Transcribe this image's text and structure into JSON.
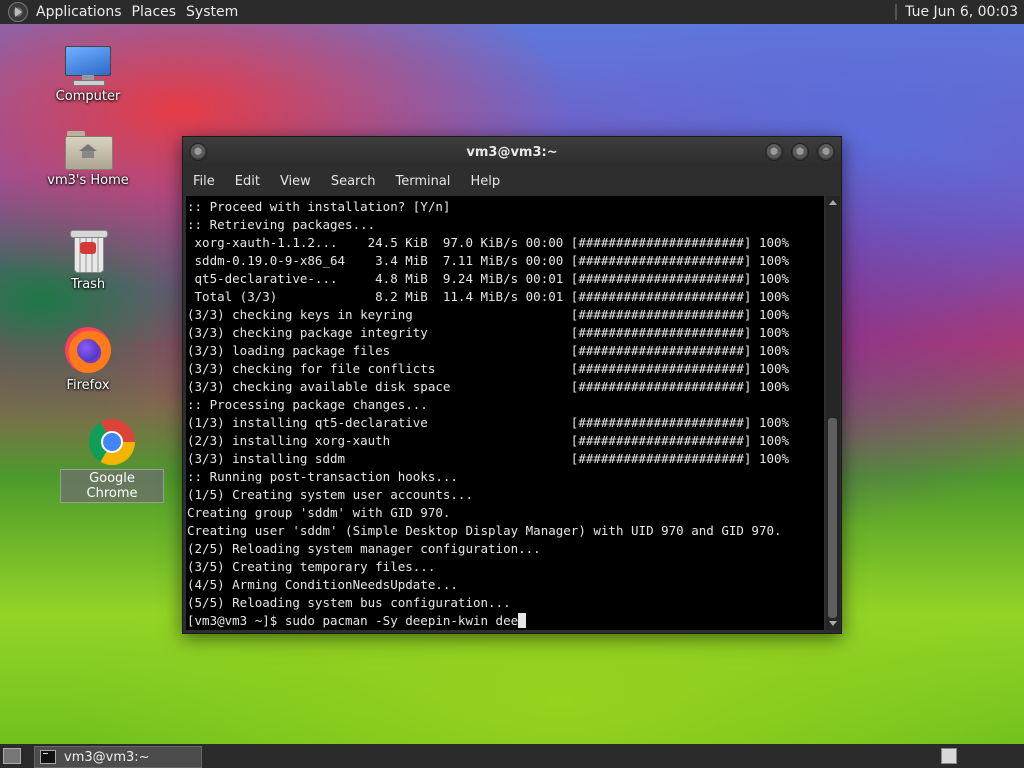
{
  "top_panel": {
    "menus": [
      "Applications",
      "Places",
      "System"
    ],
    "clock": "Tue Jun  6, 00:03"
  },
  "desktop_icons": [
    {
      "label": "Computer",
      "icon": "computer-icon"
    },
    {
      "label": "vm3's Home",
      "icon": "home-folder-icon"
    },
    {
      "label": "Trash",
      "icon": "trash-icon"
    },
    {
      "label": "Firefox",
      "icon": "firefox-icon"
    },
    {
      "label": "Google Chrome",
      "icon": "chrome-icon",
      "selected": true
    }
  ],
  "terminal": {
    "title": "vm3@vm3:~",
    "menu": [
      "File",
      "Edit",
      "View",
      "Search",
      "Terminal",
      "Help"
    ],
    "lines": [
      ":: Proceed with installation? [Y/n]",
      ":: Retrieving packages...",
      " xorg-xauth-1.1.2...    24.5 KiB  97.0 KiB/s 00:00 [######################] 100%",
      " sddm-0.19.0-9-x86_64    3.4 MiB  7.11 MiB/s 00:00 [######################] 100%",
      " qt5-declarative-...     4.8 MiB  9.24 MiB/s 00:01 [######################] 100%",
      " Total (3/3)             8.2 MiB  11.4 MiB/s 00:01 [######################] 100%",
      "(3/3) checking keys in keyring                     [######################] 100%",
      "(3/3) checking package integrity                   [######################] 100%",
      "(3/3) loading package files                        [######################] 100%",
      "(3/3) checking for file conflicts                  [######################] 100%",
      "(3/3) checking available disk space                [######################] 100%",
      ":: Processing package changes...",
      "(1/3) installing qt5-declarative                   [######################] 100%",
      "(2/3) installing xorg-xauth                        [######################] 100%",
      "(3/3) installing sddm                              [######################] 100%",
      ":: Running post-transaction hooks...",
      "(1/5) Creating system user accounts...",
      "Creating group 'sddm' with GID 970.",
      "Creating user 'sddm' (Simple Desktop Display Manager) with UID 970 and GID 970.",
      "(2/5) Reloading system manager configuration...",
      "(3/5) Creating temporary files...",
      "(4/5) Arming ConditionNeedsUpdate...",
      "(5/5) Reloading system bus configuration..."
    ],
    "prompt": "[vm3@vm3 ~]$ sudo pacman -Sy deepin-kwin dee"
  },
  "taskbar": {
    "items": [
      {
        "label": "vm3@vm3:~",
        "icon": "terminal-icon"
      }
    ]
  }
}
